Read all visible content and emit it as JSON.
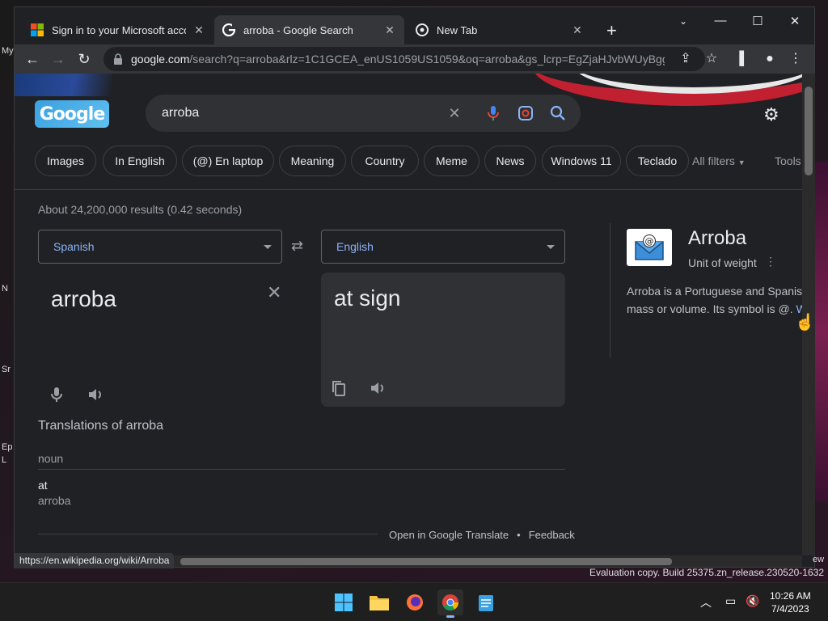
{
  "desktop": {
    "left_labels": [
      "My",
      "N",
      "Sr",
      "Ep",
      "L"
    ],
    "watermark": "Evaluation copy. Build 25375.zn_release.230520-1632",
    "right_edge_text": "ew"
  },
  "tabs": [
    {
      "title": "Sign in to your Microsoft accou",
      "active": false
    },
    {
      "title": "arroba - Google Search",
      "active": true
    },
    {
      "title": "New Tab",
      "active": false
    }
  ],
  "address_bar": {
    "url_host": "google.com",
    "url_rest": "/search?q=arroba&rlz=1C1GCEA_enUS1059US1059&oq=arroba&gs_lcrp=EgZjaHJvbWUyBgg..."
  },
  "search": {
    "query": "arroba",
    "chips": [
      "Images",
      "In English",
      "(@) En laptop",
      "Meaning",
      "Country",
      "Meme",
      "News",
      "Windows 11",
      "Teclado"
    ],
    "all_filters": "All filters",
    "tools": "Tools",
    "stats": "About 24,200,000 results (0.42 seconds)"
  },
  "translate": {
    "source_lang": "Spanish",
    "target_lang": "English",
    "source_text": "arroba",
    "target_text": "at sign",
    "translations_title": "Translations of arroba",
    "part_of_speech": "noun",
    "translation_word": "at",
    "back_translation": "arroba",
    "open_link": "Open in Google Translate",
    "separator": "•",
    "feedback": "Feedback"
  },
  "knowledge_panel": {
    "title": "Arroba",
    "subtitle": "Unit of weight",
    "more_icon": "⋮",
    "desc_line1": "Arroba is a Portuguese and Spanis",
    "desc_line2": "mass or volume. Its symbol is @.",
    "desc_link": "W"
  },
  "status_url": "https://en.wikipedia.org/wiki/Arroba",
  "taskbar": {
    "time": "10:26 AM",
    "date": "7/4/2023"
  },
  "colors": {
    "bg": "#202124",
    "link": "#8ab4f8",
    "chip_border": "#3c4043"
  }
}
